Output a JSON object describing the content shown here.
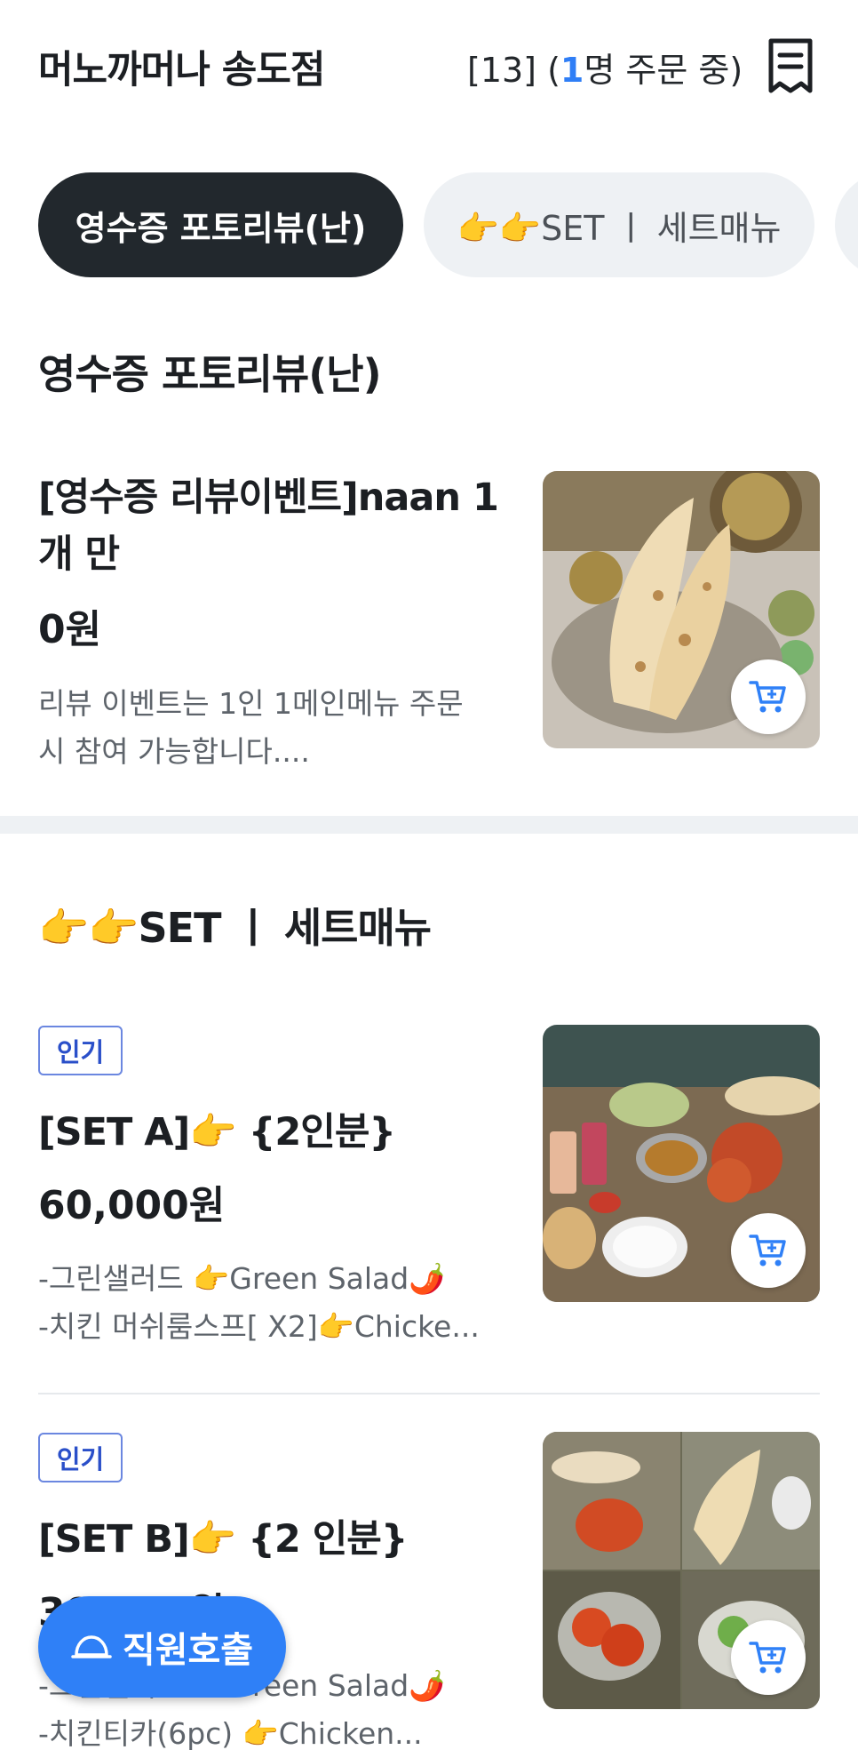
{
  "header": {
    "store_name": "머노까머나 송도점",
    "table_open": "[13] (",
    "orders_count": "1",
    "orders_suffix": "명 주문 중)",
    "receipt_icon": "receipt-icon"
  },
  "tabs": [
    {
      "label": "영수증 포토리뷰(난)",
      "active": true
    },
    {
      "label": "👉👉SET ㅣ 세트매뉴",
      "active": false
    }
  ],
  "sections": [
    {
      "title": "영수증 포토리뷰(난)",
      "items": [
        {
          "name": "[영수증 리뷰이벤트]naan 1개 만",
          "price": "0원",
          "desc_lines": [
            "리뷰 이벤트는 1인 1메인메뉴 주문",
            "시 참여 가능합니다...."
          ]
        }
      ]
    },
    {
      "title": "👉👉SET ㅣ 세트매뉴",
      "items": [
        {
          "badge": "인기",
          "name": "[SET A]👉 {2인분}",
          "price": "60,000원",
          "desc_lines": [
            "-그린샐러드 👉Green Salad🌶️",
            "-치킨 머쉬룸스프[ X2]👉Chicke..."
          ]
        },
        {
          "badge": "인기",
          "name": "[SET B]👉 {2 인분}",
          "price": "39,000원",
          "desc_lines": [
            "-그린샐러드 👉Green Salad🌶️",
            "-치킨티카(6pc) 👉Chicken..."
          ]
        }
      ]
    }
  ],
  "call_staff": {
    "label": "직원호출",
    "icon": "bell-icon"
  },
  "colors": {
    "accent": "#2f80f7",
    "tab_active_bg": "#22282d",
    "badge_border": "#6b87e0"
  }
}
